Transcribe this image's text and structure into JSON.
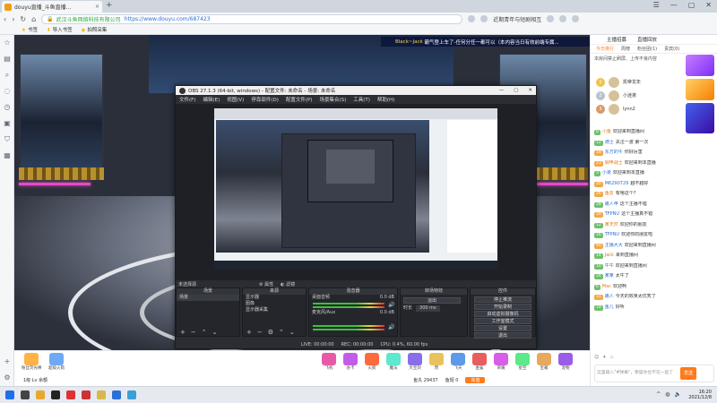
{
  "browser": {
    "tab_title": "douyu直播_斗鱼直播...",
    "url_org": "武汉斗鱼网络科技有限公司",
    "url": "https://www.douyu.com/687423",
    "search_hint": "近期青年与短剧相互",
    "new_tab": "+",
    "window_buttons": [
      "☰",
      "—",
      "▢",
      "✕"
    ]
  },
  "bookmarks": [
    "书签",
    "导入书签",
    "拍照采集"
  ],
  "video": {
    "message_user": "Black~Jack",
    "message_text": "霸气登上车了-任何分任一都可以（本内容当日有效前端专属..."
  },
  "obs": {
    "title": "OBS 27.1.3 (64-bit, windows) - 配置文件: 未命名 - 场景: 未命名",
    "menu": [
      "文件(F)",
      "编辑(E)",
      "视图(V)",
      "停靠部件(D)",
      "配置文件(P)",
      "场景集合(S)",
      "工具(T)",
      "帮助(H)"
    ],
    "no_source": "未选择源",
    "props_label": "属性",
    "filters_label": "滤镜",
    "panes": {
      "scenes": {
        "header": "场景",
        "items": [
          "场景"
        ]
      },
      "sources": {
        "header": "来源",
        "items": [
          "显示器",
          "图像",
          "显示器采集"
        ]
      },
      "mixer": {
        "header": "混音器",
        "tracks": [
          "桌面音频",
          "麦克风/Aux"
        ],
        "levels": [
          "0.0 dB",
          "0.0 dB"
        ]
      },
      "transitions": {
        "header": "转场特效",
        "type": "淡出",
        "duration_label": "时长",
        "duration": "300 ms"
      },
      "controls": {
        "header": "控件",
        "buttons": [
          "停止推流",
          "开始录制",
          "启动虚拟摄像机",
          "工作室模式",
          "设置",
          "退出"
        ]
      }
    },
    "status": [
      "LIVE: 00:00:00",
      "REC: 00:00:00",
      "CPU: 0.4%, 60.00 fps"
    ]
  },
  "gifts": [
    "粉丝荧光棒",
    "超级火箭",
    "飞机",
    "办卡",
    "火箭",
    "魔法",
    "大宝剑",
    "赞",
    "飞天",
    "金鲨",
    "荣耀",
    "星空",
    "宝箱",
    "宠物"
  ],
  "video_bar": [
    "1级   Lv 余额",
    "鱼丸  29437",
    "鱼翅  0",
    "充值"
  ],
  "chat": {
    "tabs": [
      "主播招募",
      "直播回放"
    ],
    "sub_tabs": [
      "今日排行",
      "周榜",
      "粉丝团(1)",
      "贵宾(0)"
    ],
    "notice": "本房间禁止刷屏、上传不良内容",
    "rank": [
      "凯帝龙年",
      "小迷弟",
      "lynn2"
    ],
    "messages": [
      {
        "lv": "8",
        "lv_color": "#6dc06d",
        "name": "小鱼",
        "text": "欢迎来到直播间"
      },
      {
        "lv": "12",
        "lv_color": "#6dc06d",
        "name": "骑士",
        "text": "关注一波 第一次"
      },
      {
        "lv": "18",
        "lv_color": "#f0a848",
        "name": "东方的牛",
        "text": "你好厉害"
      },
      {
        "lv": "23",
        "lv_color": "#f0a848",
        "name": "钢甲战士",
        "text": "欢迎来到本直播"
      },
      {
        "lv": "3",
        "lv_color": "#6dc06d",
        "name": "小弟",
        "text": "欢迎来到本直播"
      },
      {
        "lv": "20",
        "lv_color": "#f0a848",
        "name": "M6290729",
        "text": "越不越好"
      },
      {
        "lv": "26",
        "lv_color": "#f0a848",
        "name": "鱼友",
        "text": "有啥这个?"
      },
      {
        "lv": "28",
        "lv_color": "#6dc06d",
        "name": "路人甲",
        "text": "这个主播不错"
      },
      {
        "lv": "30",
        "lv_color": "#f0a848",
        "name": "TFPNU",
        "text": "这个主播真不错"
      },
      {
        "lv": "12",
        "lv_color": "#6dc06d",
        "name": "某天然",
        "text": "欢迎你的朋友"
      },
      {
        "lv": "16",
        "lv_color": "#6dc06d",
        "name": "TFPNU",
        "text": "欢迎你的朋友啦"
      },
      {
        "lv": "40",
        "lv_color": "#f0a848",
        "name": "主播大大",
        "text": "欢迎来到直播间"
      },
      {
        "lv": "14",
        "lv_color": "#6dc06d",
        "name": "Jack",
        "text": "来到直播间"
      },
      {
        "lv": "10",
        "lv_color": "#6dc06d",
        "name": "牛牛",
        "text": "欢迎来到直播间"
      },
      {
        "lv": "24",
        "lv_color": "#6dc06d",
        "name": "某某",
        "text": "太牛了"
      },
      {
        "lv": "6",
        "lv_color": "#6dc06d",
        "name": "Mac",
        "text": "欢迎啊"
      },
      {
        "lv": "31",
        "lv_color": "#f0a848",
        "name": "路人",
        "text": "今天的效果太优秀了"
      },
      {
        "lv": "19",
        "lv_color": "#6dc06d",
        "name": "鱼儿",
        "text": "好听"
      }
    ],
    "input_placeholder": "这里输入\"#弹幕\"，要是你也不在一起了",
    "send": "发送"
  },
  "taskbar": {
    "time": "16:20",
    "date": "2021/12/8"
  }
}
